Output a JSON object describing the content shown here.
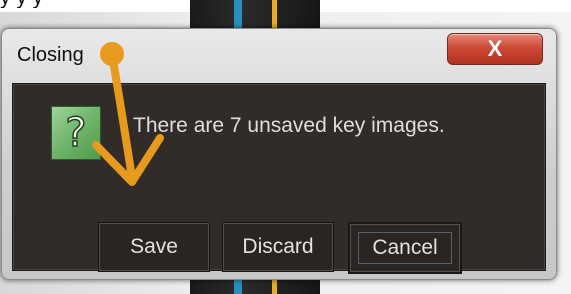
{
  "background": {
    "caption_text": "y      y       y"
  },
  "dialog": {
    "title": "Closing",
    "close_label": "X",
    "message": "There are 7 unsaved key images.",
    "icon": "question-mark-icon",
    "buttons": {
      "save": "Save",
      "discard": "Discard",
      "cancel": "Cancel"
    }
  },
  "annotation": {
    "arrow_color": "#e79a1e"
  }
}
